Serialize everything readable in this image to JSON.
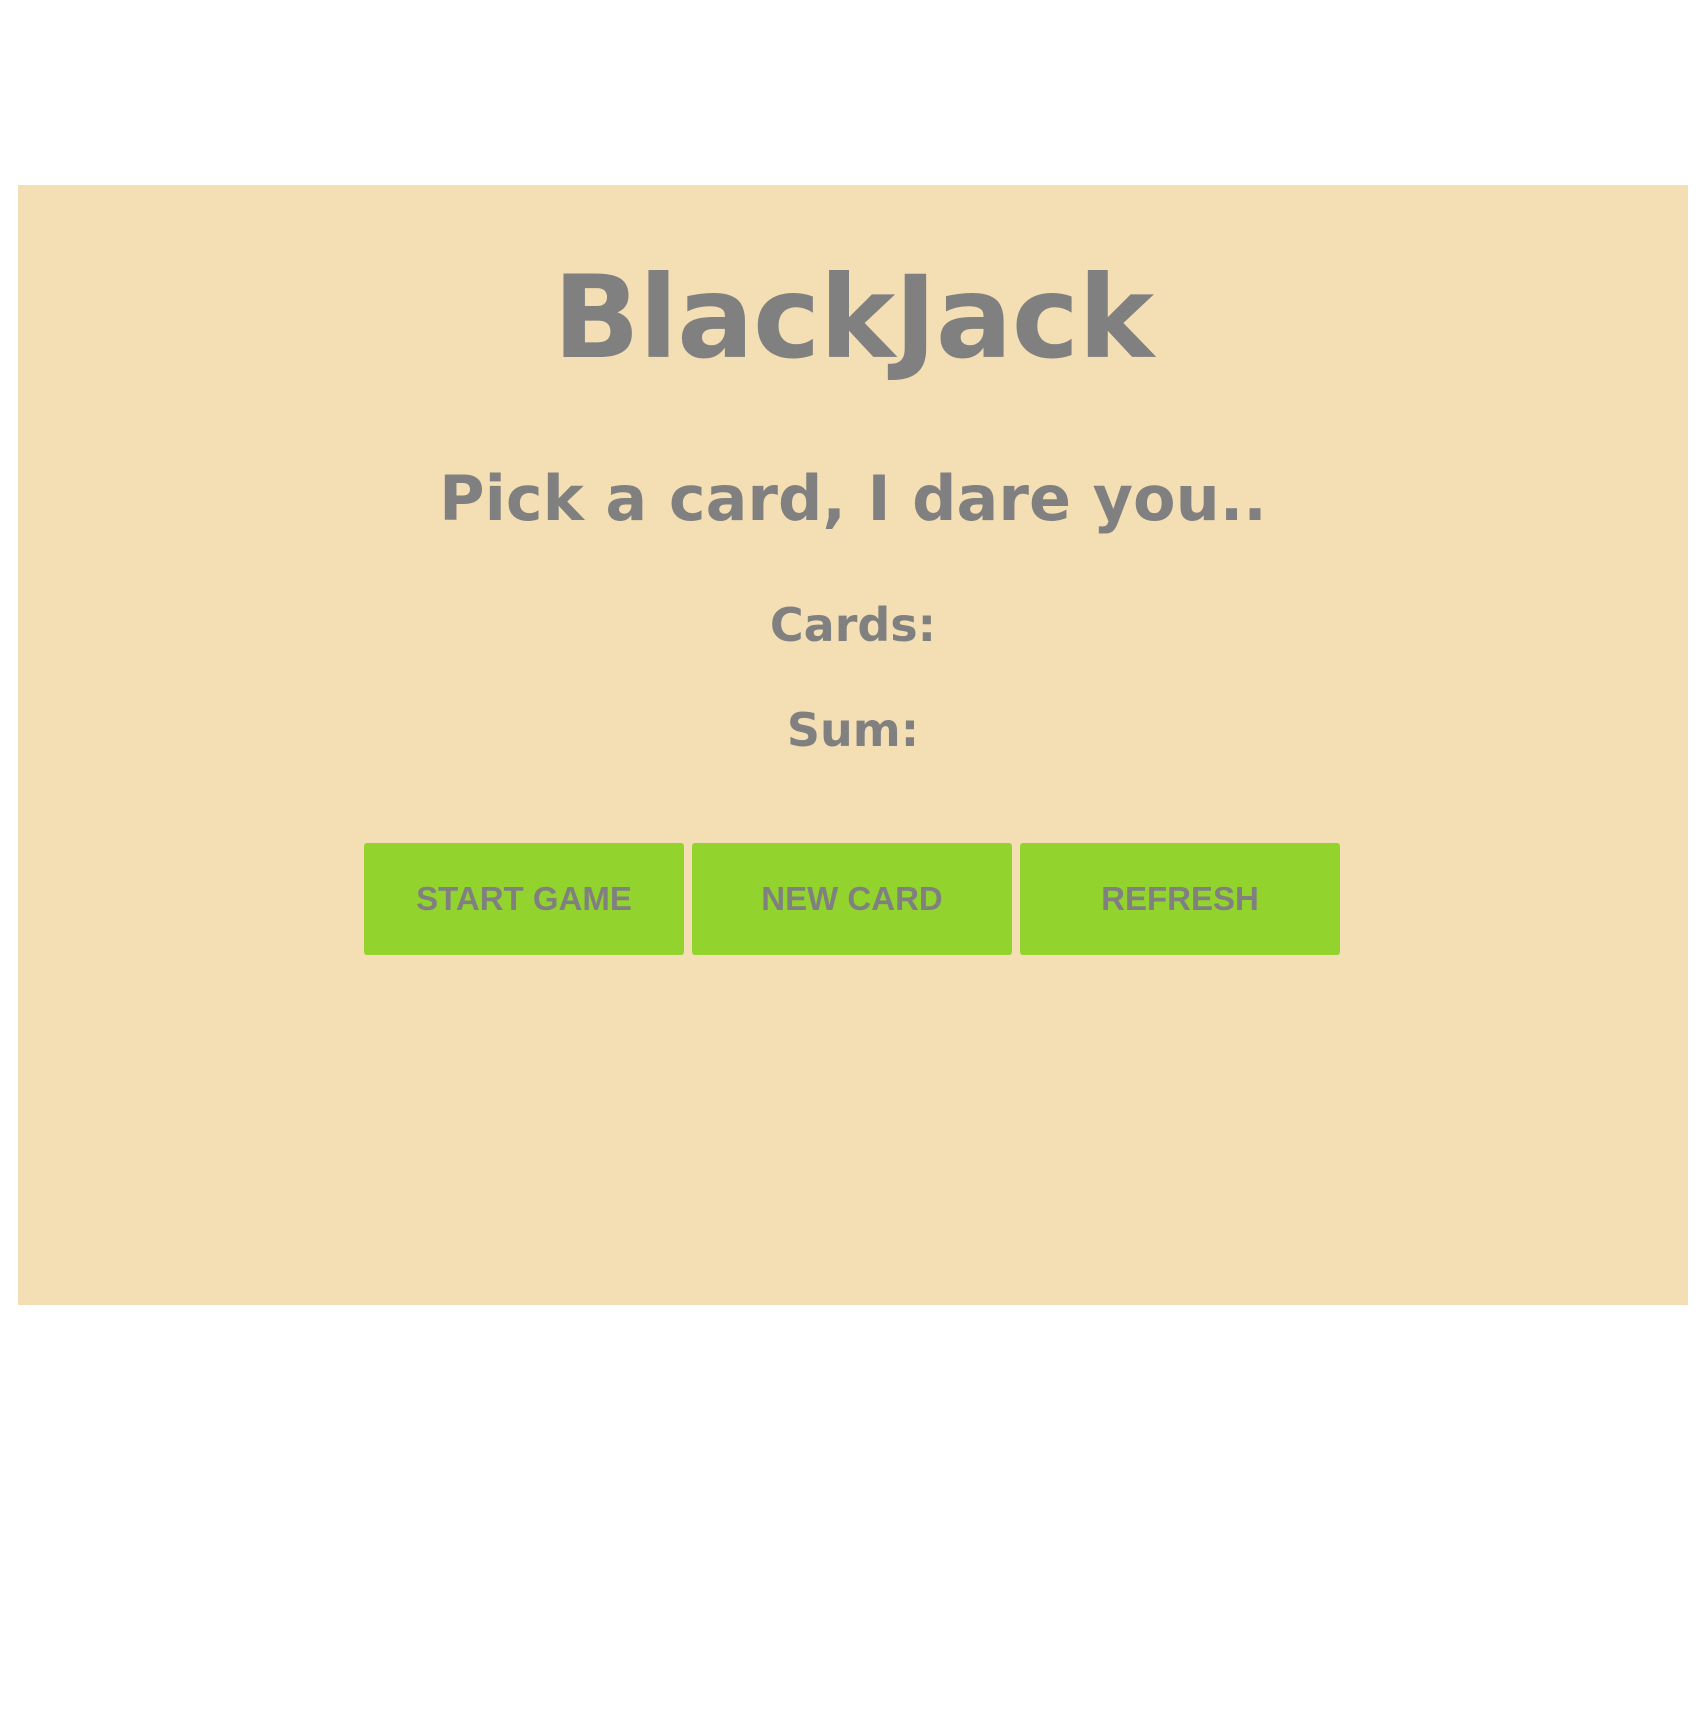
{
  "game": {
    "title": "BlackJack",
    "message": "Pick a card, I dare you..",
    "cards_label": "Cards:",
    "sum_label": "Sum:",
    "colors": {
      "panel_background": "#f4dfb5",
      "text": "#808080",
      "button_background": "#92d42d"
    }
  },
  "buttons": {
    "start_game": "START GAME",
    "new_card": "NEW CARD",
    "refresh": "REFRESH"
  }
}
